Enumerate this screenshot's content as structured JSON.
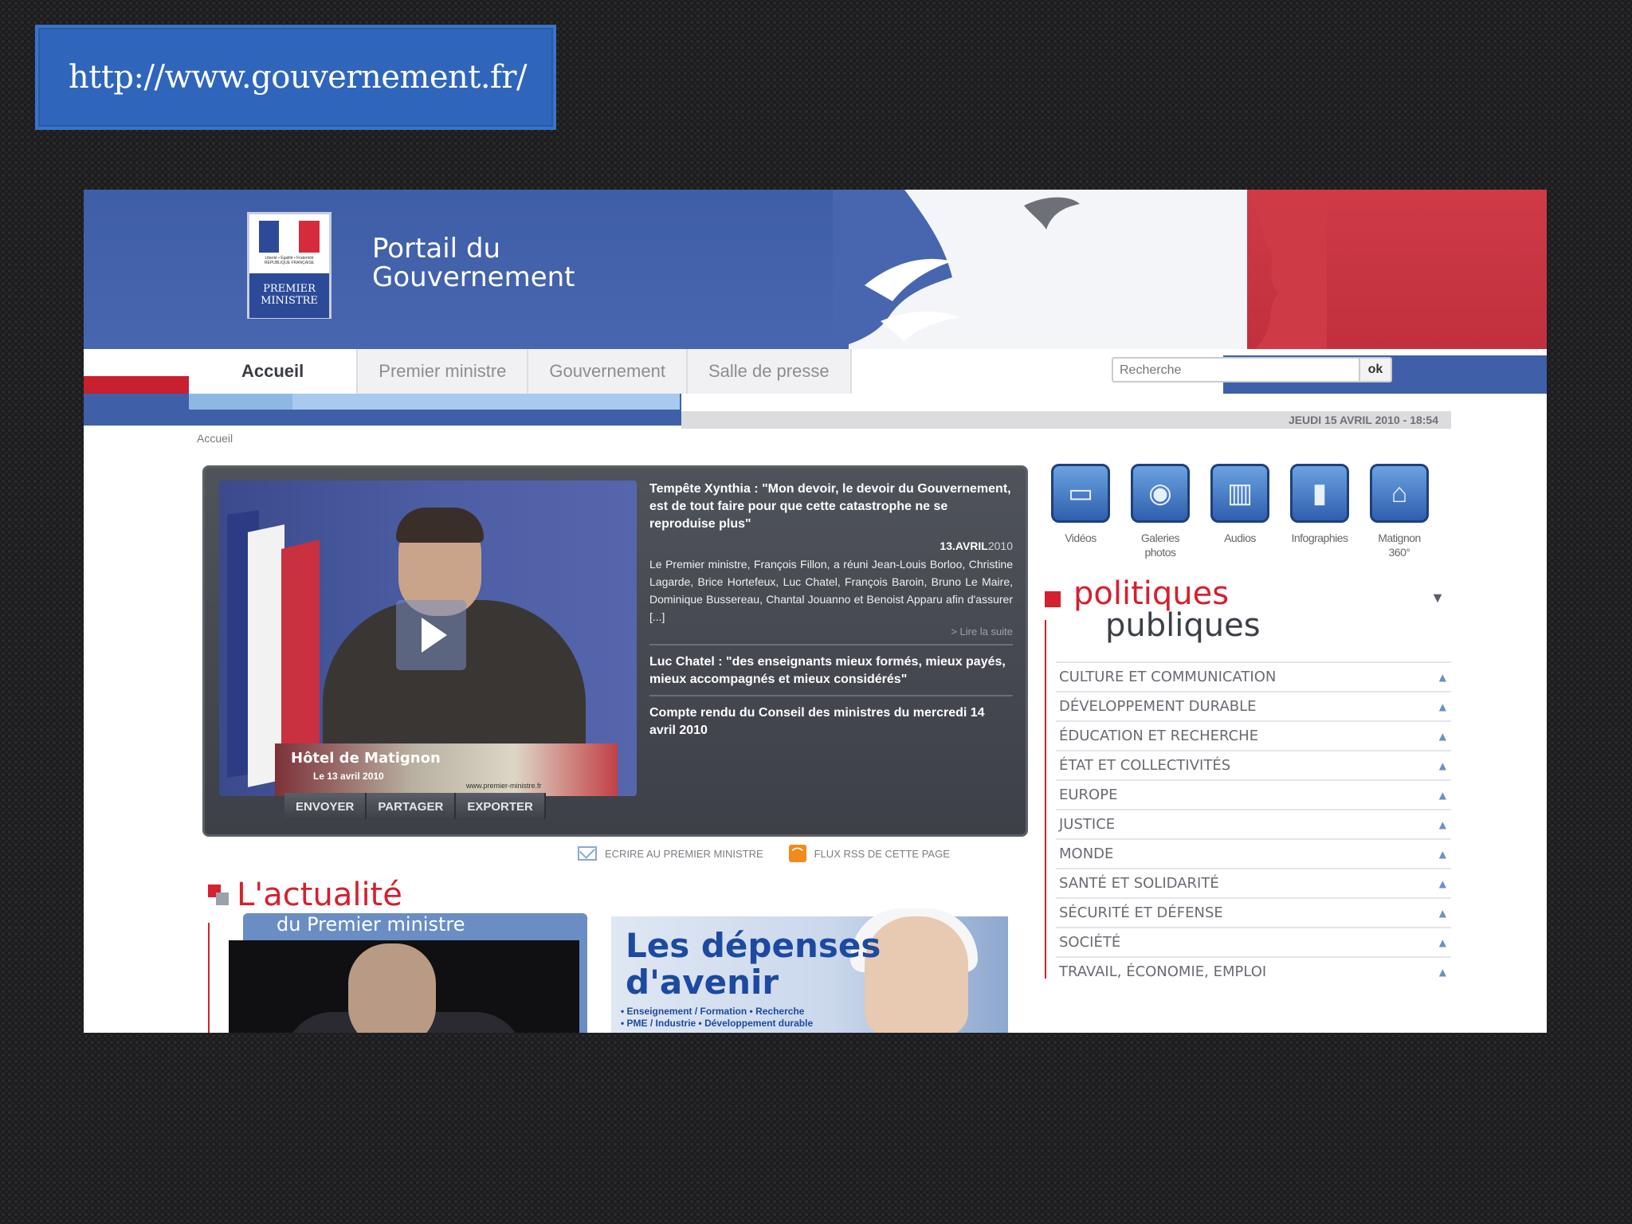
{
  "banner": {
    "url": "http://www.gouvernement.fr/"
  },
  "header": {
    "logo_small_text": "Liberté • Égalité • Fraternité RÉPUBLIQUE FRANÇAISE",
    "logo_pm": "PREMIER MINISTRE",
    "portal_title_line1": "Portail du",
    "portal_title_line2": "Gouvernement"
  },
  "nav": {
    "tabs": [
      {
        "label": "Accueil",
        "active": true
      },
      {
        "label": "Premier ministre",
        "active": false
      },
      {
        "label": "Gouvernement",
        "active": false
      },
      {
        "label": "Salle de presse",
        "active": false
      }
    ],
    "search_placeholder": "Recherche",
    "search_button": "ok"
  },
  "datebar": {
    "date": "JEUDI 15 AVRIL 2010 - 18:54"
  },
  "breadcrumb": "Accueil",
  "video": {
    "overlay_title": "Hôtel de Matignon",
    "overlay_date": "Le 13 avril 2010",
    "overlay_site": "www.premier-ministre.fr",
    "actions": [
      "ENVOYER",
      "PARTAGER",
      "EXPORTER"
    ]
  },
  "news": [
    {
      "title": "Tempête Xynthia : \"Mon devoir, le devoir du Gouvernement, est de tout faire pour que cette catastrophe ne se reproduise plus\"",
      "date_day": "13.AVRIL",
      "date_year": "2010",
      "body": "Le Premier ministre, François Fillon, a réuni Jean-Louis Borloo, Christine Lagarde, Brice Hortefeux, Luc Chatel, François Baroin, Bruno Le Maire, Dominique Bussereau, Chantal Jouanno et Benoist Apparu afin d'assurer [...]",
      "more": "> Lire la suite"
    },
    {
      "title": "Luc Chatel : \"des enseignants mieux formés, mieux payés, mieux accompagnés et mieux considérés\""
    },
    {
      "title": "Compte rendu du Conseil des ministres du mercredi 14 avril 2010"
    }
  ],
  "links": {
    "write": "ECRIRE AU PREMIER MINISTRE",
    "rss": "FLUX RSS DE CETTE PAGE"
  },
  "actualite": {
    "title": "L'actualité",
    "subtitle": "du Premier ministre"
  },
  "depenses": {
    "title_line1": "Les dépenses",
    "title_line2": "d'avenir",
    "sub_line1": "• Enseignement / Formation • Recherche",
    "sub_line2": "• PME / Industrie • Développement durable"
  },
  "media": [
    {
      "label": "Vidéos",
      "icon": "film-icon"
    },
    {
      "label": "Galeries photos",
      "icon": "camera-icon"
    },
    {
      "label": "Audios",
      "icon": "equalizer-icon"
    },
    {
      "label": "Infographies",
      "icon": "bar-chart-icon"
    },
    {
      "label": "Matignon 360°",
      "icon": "building-icon"
    }
  ],
  "politiques": {
    "title_line1": "politiques",
    "title_line2": "publiques",
    "items": [
      "CULTURE ET COMMUNICATION",
      "DÉVELOPPEMENT DURABLE",
      "ÉDUCATION ET RECHERCHE",
      "ÉTAT ET COLLECTIVITÉS",
      "EUROPE",
      "JUSTICE",
      "MONDE",
      "SANTÉ ET SOLIDARITÉ",
      "SÉCURITÉ ET DÉFENSE",
      "SOCIÉTÉ",
      "TRAVAIL, ÉCONOMIE, EMPLOI"
    ]
  },
  "colors": {
    "accent_blue": "#3f5fa8",
    "accent_red": "#d5202e",
    "banner_blue": "#2f66bb"
  }
}
